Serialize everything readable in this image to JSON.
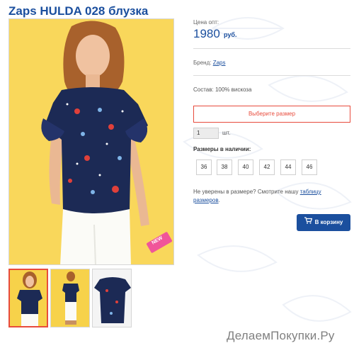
{
  "product": {
    "title": "Zaps HULDA 028 блузка",
    "new_badge": "NEW"
  },
  "price": {
    "label": "Цена опт:",
    "value": "1980",
    "currency": "руб."
  },
  "brand": {
    "label": "Бренд:",
    "name": "Zaps"
  },
  "composition": "Состав: 100% вискоза",
  "size_select": {
    "label": "Выберите размер"
  },
  "quantity": {
    "value": "1",
    "unit": "шт."
  },
  "sizes": {
    "title": "Размеры в наличии:",
    "items": [
      "36",
      "38",
      "40",
      "42",
      "44",
      "46"
    ]
  },
  "size_hint": {
    "text": "Не уверены в размере? Смотрите нашу",
    "link": "таблицу размеров",
    "suffix": "."
  },
  "cart_button": {
    "label": "В корзину",
    "icon": "cart-icon"
  },
  "watermark": "ДелаемПокупки.Ру",
  "colors": {
    "accent": "#1b4f9e",
    "alert": "#e84b3c",
    "photo_bg": "#f7d24a",
    "blouse": "#1c2a55",
    "badge": "#f0559a"
  }
}
